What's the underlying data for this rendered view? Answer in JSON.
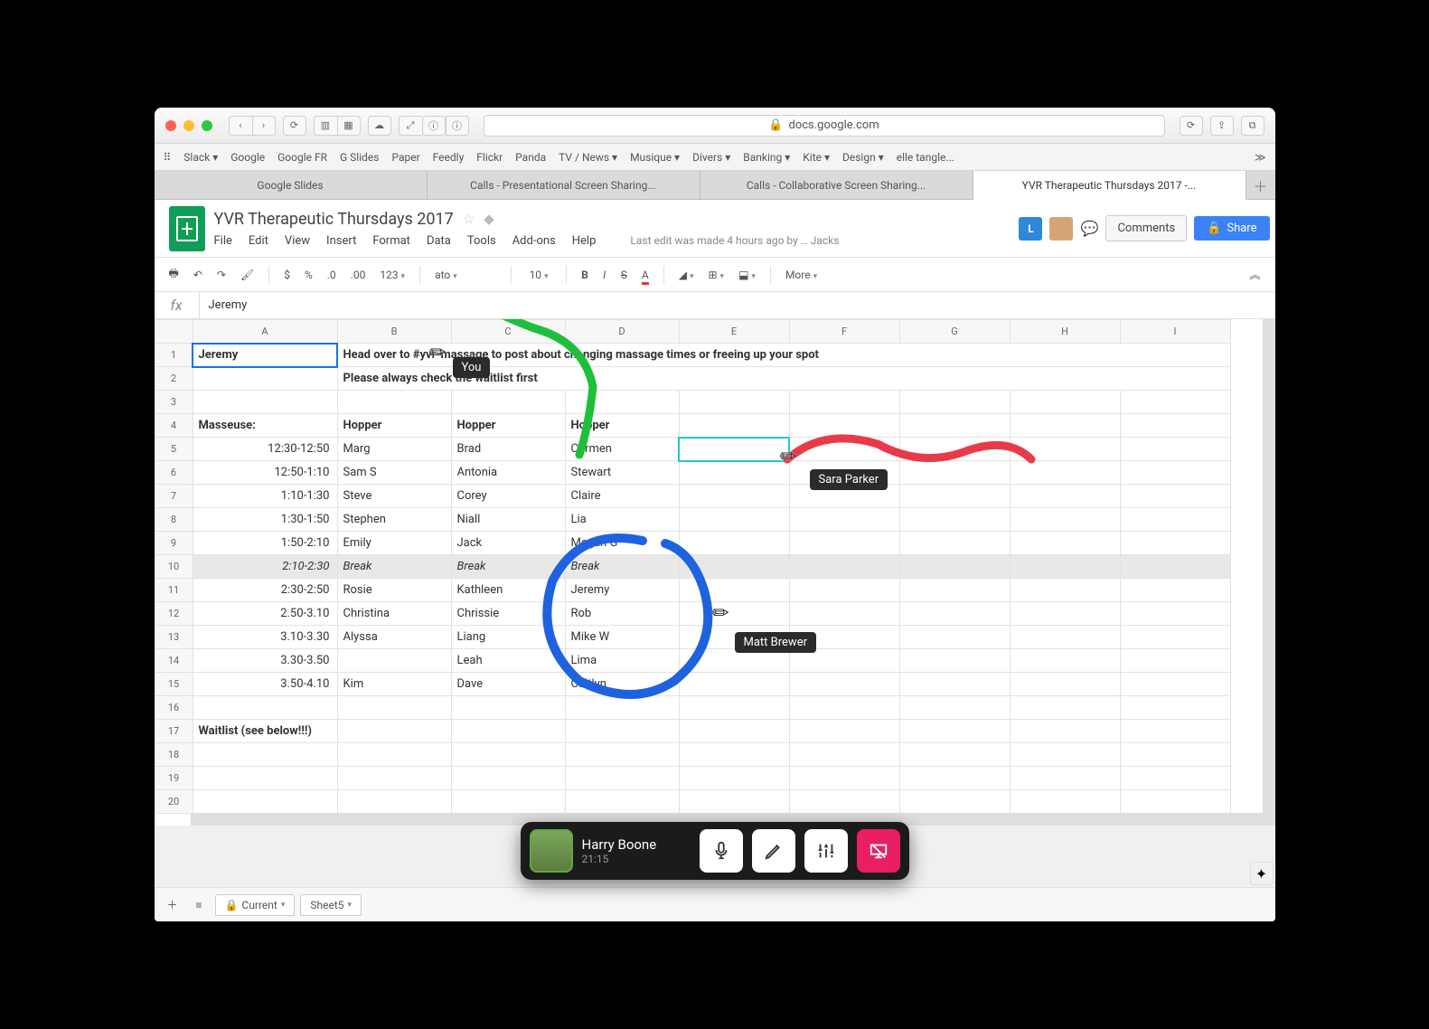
{
  "browser": {
    "url_host": "docs.google.com",
    "bookmarks": [
      "Slack",
      "Google",
      "Google FR",
      "G Slides",
      "Paper",
      "Feedly",
      "Flickr",
      "Panda",
      "TV / News",
      "Musique",
      "Divers",
      "Banking",
      "Kite",
      "Design",
      "elle tangle..."
    ],
    "bookmark_dropdown": [
      true,
      false,
      false,
      false,
      false,
      false,
      false,
      false,
      true,
      true,
      true,
      true,
      true,
      true,
      false
    ],
    "tabs": [
      "Google Slides",
      "Calls - Presentational Screen Sharing...",
      "Calls - Collaborative Screen Sharing...",
      "YVR Therapeutic Thursdays 2017 -..."
    ],
    "activeTab": 3
  },
  "doc": {
    "title": "YVR Therapeutic Thursdays 2017",
    "menus": [
      "File",
      "Edit",
      "View",
      "Insert",
      "Format",
      "Data",
      "Tools",
      "Add-ons",
      "Help"
    ],
    "last_edit": "Last edit was made 4 hours ago by",
    "last_edit_user_fragment": "Jacks",
    "comments_label": "Comments",
    "share_label": "Share",
    "collaborator_badge": "L"
  },
  "toolbar": {
    "font_name_fragment": "ato",
    "font_size": "10",
    "more_label": "More"
  },
  "formula": {
    "fx": "fx",
    "value": "Jeremy"
  },
  "sheet": {
    "columns": [
      "A",
      "B",
      "C",
      "D",
      "E",
      "F",
      "G",
      "H",
      "I"
    ],
    "rows": [
      {
        "n": 1,
        "A": "Jeremy",
        "B": "Head over to #yvr-massage to post about changing massage times or freeing up your spot",
        "bold": true,
        "spanB": true
      },
      {
        "n": 2,
        "A": "",
        "B": "Please always check the waitlist first",
        "bold": true,
        "spanB": true
      },
      {
        "n": 3
      },
      {
        "n": 4,
        "A": "Masseuse:",
        "B": "Hopper",
        "C": "Hopper",
        "D": "Hopper",
        "bold": true
      },
      {
        "n": 5,
        "A": "12:30-12:50",
        "B": "Marg",
        "C": "Brad",
        "D": "Carmen",
        "ra": true,
        "activeE": true
      },
      {
        "n": 6,
        "A": "12:50-1:10",
        "B": "Sam S",
        "C": "Antonia",
        "D": "Stewart",
        "ra": true
      },
      {
        "n": 7,
        "A": "1:10-1:30",
        "B": "Steve",
        "C": "Corey",
        "D": "Claire",
        "ra": true
      },
      {
        "n": 8,
        "A": "1:30-1:50",
        "B": "Stephen",
        "C": "Niall",
        "D": "Lia",
        "ra": true
      },
      {
        "n": 9,
        "A": "1:50-2:10",
        "B": "Emily",
        "C": "Jack",
        "D": "Megan G",
        "ra": true
      },
      {
        "n": 10,
        "A": "2:10-2:30",
        "B": "Break",
        "C": "Break",
        "D": "Break",
        "ra": true,
        "break": true
      },
      {
        "n": 11,
        "A": "2:30-2:50",
        "B": "Rosie",
        "C": "Kathleen",
        "D": "Jeremy",
        "ra": true
      },
      {
        "n": 12,
        "A": "2.50-3.10",
        "B": "Christina",
        "C": "Chrissie",
        "D": "Rob",
        "ra": true
      },
      {
        "n": 13,
        "A": "3.10-3.30",
        "B": "Alyssa",
        "C": "Liang",
        "D": "Mike W",
        "ra": true
      },
      {
        "n": 14,
        "A": "3.30-3.50",
        "B": "",
        "C": "Leah",
        "D": "Lima",
        "ra": true
      },
      {
        "n": 15,
        "A": "3.50-4.10",
        "B": "Kim",
        "C": "Dave",
        "D": "Caitlyn",
        "ra": true
      },
      {
        "n": 16
      },
      {
        "n": 17,
        "A": "Waitlist (see below!!!)",
        "bold": true
      },
      {
        "n": 18
      },
      {
        "n": 19
      },
      {
        "n": 20
      }
    ],
    "active_cell": "A1",
    "footer_tabs": [
      {
        "label": "Current",
        "locked": true
      },
      {
        "label": "Sheet5",
        "locked": false
      }
    ]
  },
  "annotations": {
    "you": "You",
    "sara": "Sara Parker",
    "matt": "Matt Brewer",
    "colors": {
      "you": "#1fbf3b",
      "sara": "#e83b4a",
      "matt": "#1e62e0"
    }
  },
  "call": {
    "name": "Harry Boone",
    "time": "21:15"
  }
}
